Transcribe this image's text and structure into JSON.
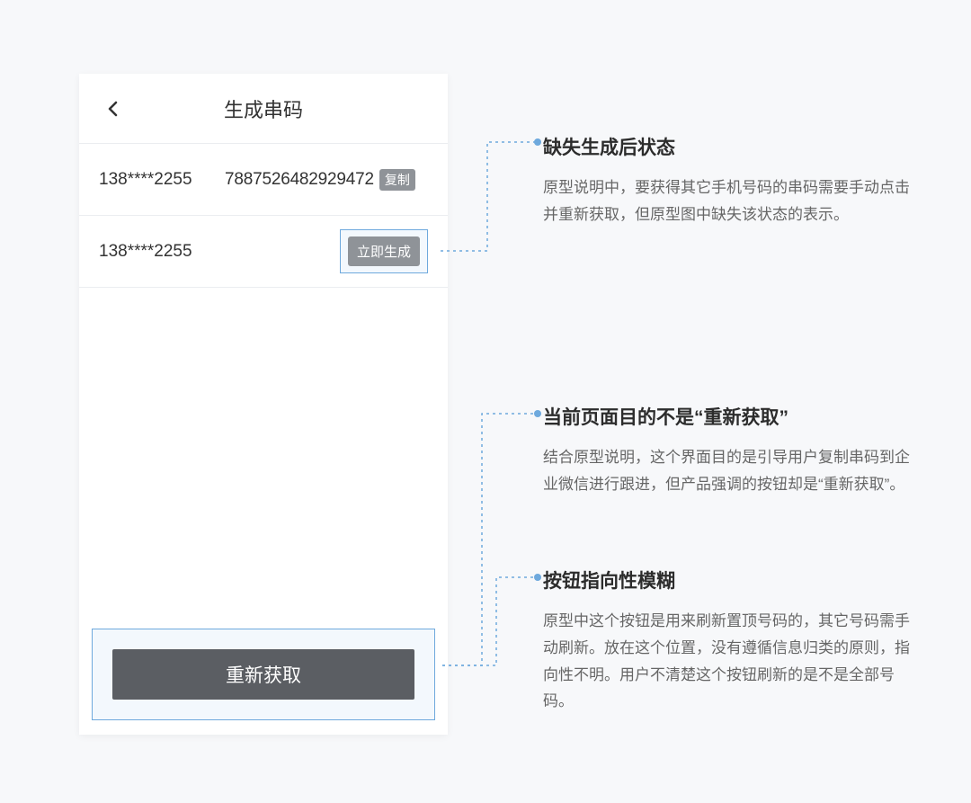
{
  "phone": {
    "title": "生成串码",
    "rows": [
      {
        "number": "138****2255",
        "code": "7887526482929472",
        "copy_label": "复制"
      },
      {
        "number": "138****2255",
        "generate_label": "立即生成"
      }
    ],
    "refresh_label": "重新获取"
  },
  "annotations": [
    {
      "title": "缺失生成后状态",
      "body": "原型说明中，要获得其它手机号码的串码需要手动点击并重新获取，但原型图中缺失该状态的表示。"
    },
    {
      "title": "当前页面目的不是“重新获取”",
      "body": "结合原型说明，这个界面目的是引导用户复制串码到企业微信进行跟进，但产品强调的按钮却是“重新获取”。"
    },
    {
      "title": "按钮指向性模糊",
      "body": "原型中这个按钮是用来刷新置顶号码的，其它号码需手动刷新。放在这个位置，没有遵循信息归类的原则，指向性不明。用户不清楚这个按钮刷新的是不是全部号码。"
    }
  ]
}
